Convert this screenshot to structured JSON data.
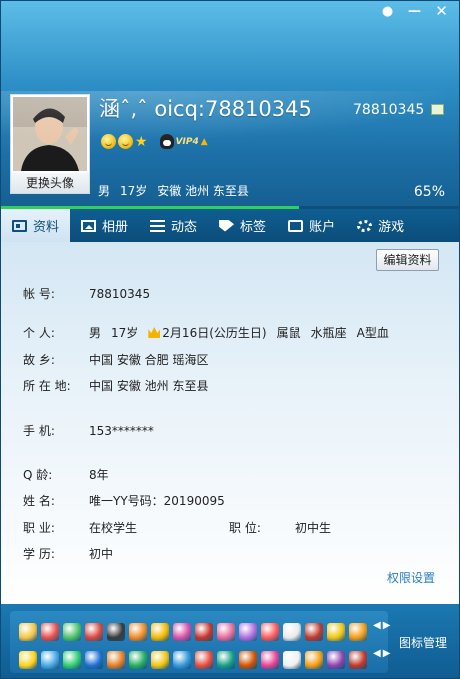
{
  "window": {
    "controls": [
      "pin",
      "minimize",
      "close"
    ]
  },
  "profile": {
    "nickname": "涵ˆ,ˆ  oicq:78810345",
    "qq_number": "78810345",
    "change_avatar_label": "更换头像",
    "gender": "男",
    "age": "17岁",
    "location": "安徽 池州 东至县",
    "vip_label": "VIP4",
    "completion": "65%",
    "completion_value": 0.65
  },
  "tabs": [
    {
      "label": "资料",
      "icon": "card-icon",
      "active": true
    },
    {
      "label": "相册",
      "icon": "photo-icon",
      "active": false
    },
    {
      "label": "动态",
      "icon": "list-icon",
      "active": false
    },
    {
      "label": "标签",
      "icon": "tag-icon",
      "active": false
    },
    {
      "label": "账户",
      "icon": "wallet-icon",
      "active": false
    },
    {
      "label": "游戏",
      "icon": "game-icon",
      "active": false
    }
  ],
  "details": {
    "edit_button": "编辑资料",
    "account": {
      "label": "帐    号:",
      "value": "78810345"
    },
    "personal": {
      "label": "个    人:",
      "gender": "男",
      "age": "17岁",
      "birthday": "2月16日(公历生日)",
      "zodiac": "属鼠",
      "constellation": "水瓶座",
      "blood": "A型血"
    },
    "hometown": {
      "label": "故    乡:",
      "value": "中国 安徽 合肥 瑶海区"
    },
    "residence": {
      "label": "所 在 地:",
      "value": "中国 安徽 池州 东至县"
    },
    "mobile": {
      "label": "手    机:",
      "value": "153*******"
    },
    "qage": {
      "label": "Q    龄:",
      "value": "8年"
    },
    "name": {
      "label": "姓    名:",
      "value": "唯一YY号码：20190095"
    },
    "job": {
      "label": "职    业:",
      "value": "在校学生"
    },
    "position": {
      "label": "职    位:",
      "value": "初中生"
    },
    "education": {
      "label": "学    历:",
      "value": "初中"
    },
    "permissions_link": "权限设置"
  },
  "footer": {
    "manage_label": "图标管理",
    "row1_colors": [
      "#f4c542",
      "#e8504a",
      "#4cc36a",
      "#d9473d",
      "#3a3a3a",
      "#f08a24",
      "#f5b800",
      "#d94fa8",
      "#c8342b",
      "#e86a9a",
      "#b06de0",
      "#ff5a5a",
      "#e9e9e9",
      "#c0392b",
      "#f1c40f",
      "#f39c12"
    ],
    "row2_colors": [
      "#ffd21a",
      "#48a9e6",
      "#2ecc71",
      "#1f6fd0",
      "#e67e22",
      "#27ae60",
      "#f1c40f",
      "#3498db",
      "#e74c3c",
      "#16a085",
      "#d35400",
      "#e84393",
      "#f0f0f0",
      "#f39c12",
      "#8e44ad",
      "#c0392b"
    ]
  }
}
